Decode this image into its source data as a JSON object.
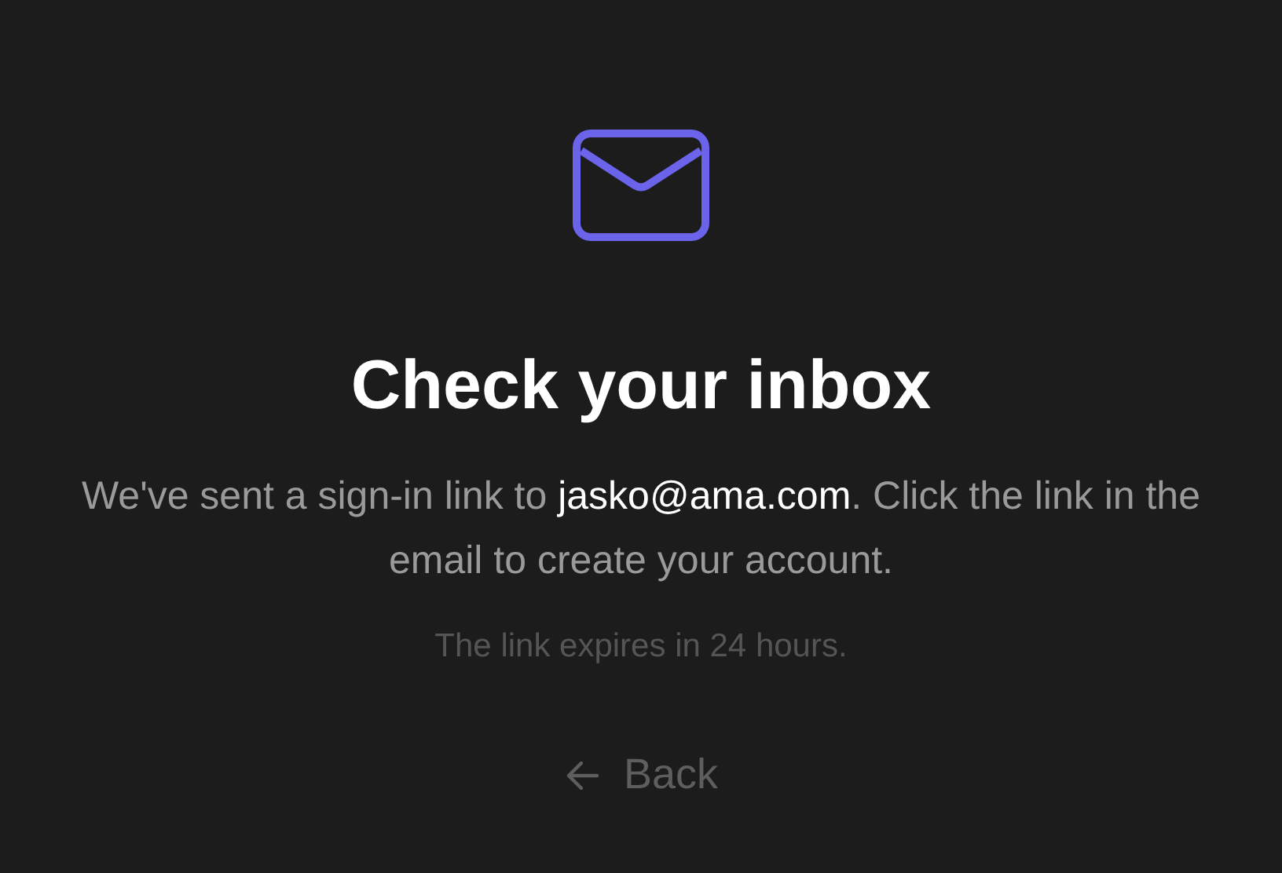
{
  "title": "Check your inbox",
  "message": "We've sent a sign-in link to **jasko@ama.com**. Click the link in the email to create your account.",
  "note": "The link expires in 24 hours.",
  "back_link": {
    "label": "Back"
  }
}
